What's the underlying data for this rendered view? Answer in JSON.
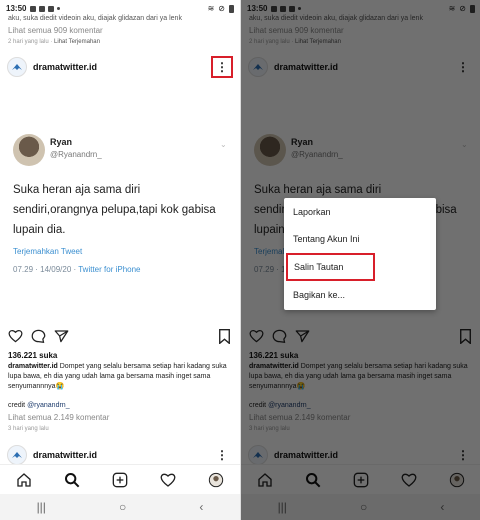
{
  "status_bar": {
    "time": "13:50"
  },
  "feed": {
    "prev_post": {
      "caption_fragment": "aku, suka diedit videoin aku, diajak glidazan dari ya lenk",
      "view_comments": "Lihat semua 909 komentar",
      "ago": "2 hari yang lalu",
      "translate_link": "Lihat Terjemahan"
    },
    "post": {
      "account": "dramatwitter.id",
      "more_menu_symbol": "⋮",
      "tweet": {
        "name": "Ryan",
        "username": "@Ryanandrn_",
        "text": "Suka heran aja sama diri sendiri,orangnya pelupa,tapi kok gabisa lupain dia.",
        "translate_label": "Terjemahkan Tweet",
        "timestamp": "07.29 · 14/09/20 · ",
        "source": "Twitter for iPhone"
      },
      "likes": "136.221 suka",
      "caption": {
        "account": "dramatwitter.id",
        "text": " Dompet yang selalu bersama setiap hari kadang suka lupa bawa, eh dia yang udah lama ga bersama masih inget sama senyumannnya😭"
      },
      "credit_label": "credit ",
      "credit_tag": "@ryanandrn_",
      "view_comments": "Lihat semua 2.149 komentar",
      "ago": "3 hari yang lalu"
    },
    "next_post": {
      "account": "dramatwitter.id"
    }
  },
  "bottom_nav": {
    "items": [
      "home-icon",
      "search-icon",
      "new-post-icon",
      "activity-heart-icon",
      "profile-avatar"
    ]
  },
  "system_nav": {
    "recents": "|||",
    "home": "○",
    "back": "‹"
  },
  "context_menu": {
    "items": [
      "Laporkan",
      "Tentang Akun Ini",
      "Salin Tautan",
      "Bagikan ke..."
    ],
    "highlighted_item": "Salin Tautan"
  },
  "colors": {
    "highlight_red": "#d81f2a",
    "link_blue": "#3b8fd0",
    "overlay": "rgba(0,0,0,0.56)"
  }
}
